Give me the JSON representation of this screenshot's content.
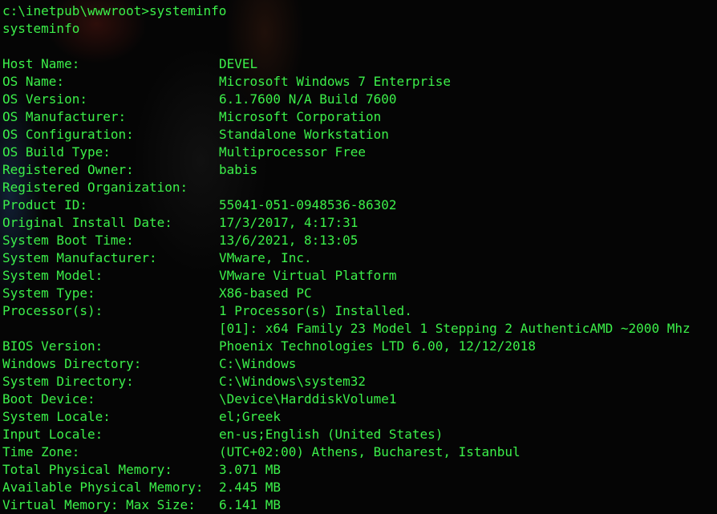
{
  "terminal": {
    "prompt": "c:\\inetpub\\wwwroot>systeminfo",
    "echo": "systeminfo",
    "rows": [
      {
        "label": "Host Name:",
        "value": "DEVEL"
      },
      {
        "label": "OS Name:",
        "value": "Microsoft Windows 7 Enterprise"
      },
      {
        "label": "OS Version:",
        "value": "6.1.7600 N/A Build 7600"
      },
      {
        "label": "OS Manufacturer:",
        "value": "Microsoft Corporation"
      },
      {
        "label": "OS Configuration:",
        "value": "Standalone Workstation"
      },
      {
        "label": "OS Build Type:",
        "value": "Multiprocessor Free"
      },
      {
        "label": "Registered Owner:",
        "value": "babis"
      },
      {
        "label": "Registered Organization:",
        "value": ""
      },
      {
        "label": "Product ID:",
        "value": "55041-051-0948536-86302"
      },
      {
        "label": "Original Install Date:",
        "value": "17/3/2017, 4:17:31"
      },
      {
        "label": "System Boot Time:",
        "value": "13/6/2021, 8:13:05"
      },
      {
        "label": "System Manufacturer:",
        "value": "VMware, Inc."
      },
      {
        "label": "System Model:",
        "value": "VMware Virtual Platform"
      },
      {
        "label": "System Type:",
        "value": "X86-based PC"
      },
      {
        "label": "Processor(s):",
        "value": "1 Processor(s) Installed."
      },
      {
        "label": "",
        "value": "[01]: x64 Family 23 Model 1 Stepping 2 AuthenticAMD ~2000 Mhz"
      },
      {
        "label": "BIOS Version:",
        "value": "Phoenix Technologies LTD 6.00, 12/12/2018"
      },
      {
        "label": "Windows Directory:",
        "value": "C:\\Windows"
      },
      {
        "label": "System Directory:",
        "value": "C:\\Windows\\system32"
      },
      {
        "label": "Boot Device:",
        "value": "\\Device\\HarddiskVolume1"
      },
      {
        "label": "System Locale:",
        "value": "el;Greek"
      },
      {
        "label": "Input Locale:",
        "value": "en-us;English (United States)"
      },
      {
        "label": "Time Zone:",
        "value": "(UTC+02:00) Athens, Bucharest, Istanbul"
      },
      {
        "label": "Total Physical Memory:",
        "value": "3.071 MB"
      },
      {
        "label": "Available Physical Memory:",
        "value": "2.445 MB"
      },
      {
        "label": "Virtual Memory: Max Size:",
        "value": "6.141 MB"
      }
    ]
  },
  "colors": {
    "text": "#3cf04a",
    "background": "#050505"
  }
}
